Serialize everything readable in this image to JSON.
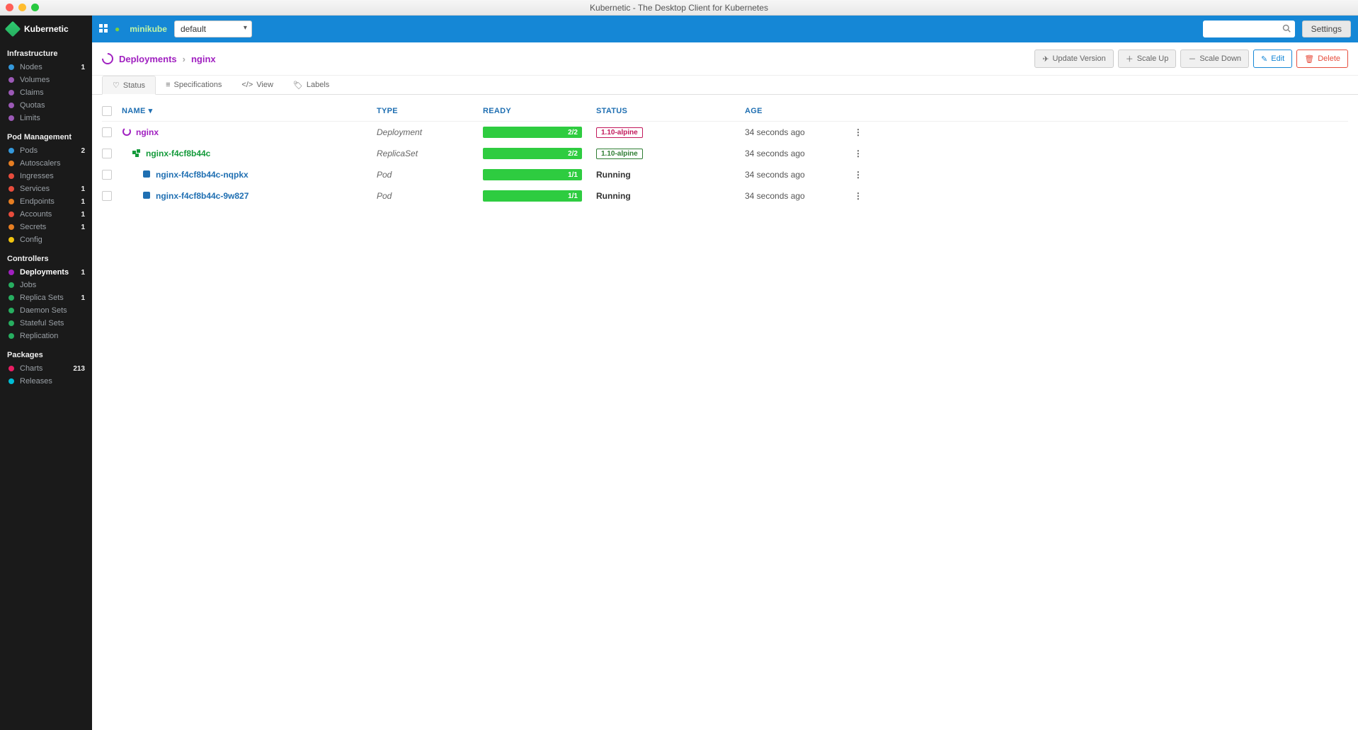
{
  "window": {
    "title": "Kubernetic - The Desktop Client for Kubernetes"
  },
  "brand": {
    "name": "Kubernetic"
  },
  "topbar": {
    "cluster": "minikube",
    "namespace": "default",
    "search_placeholder": "",
    "settings_label": "Settings"
  },
  "sidebar": {
    "sections": [
      {
        "heading": "Infrastructure",
        "items": [
          {
            "label": "Nodes",
            "badge": "1",
            "color": "#3498db"
          },
          {
            "label": "Volumes",
            "badge": "",
            "color": "#9b59b6"
          },
          {
            "label": "Claims",
            "badge": "",
            "color": "#9b59b6"
          },
          {
            "label": "Quotas",
            "badge": "",
            "color": "#9b59b6"
          },
          {
            "label": "Limits",
            "badge": "",
            "color": "#9b59b6"
          }
        ]
      },
      {
        "heading": "Pod Management",
        "items": [
          {
            "label": "Pods",
            "badge": "2",
            "color": "#3498db"
          },
          {
            "label": "Autoscalers",
            "badge": "",
            "color": "#e67e22"
          },
          {
            "label": "Ingresses",
            "badge": "",
            "color": "#e74c3c"
          },
          {
            "label": "Services",
            "badge": "1",
            "color": "#e74c3c"
          },
          {
            "label": "Endpoints",
            "badge": "1",
            "color": "#e67e22"
          },
          {
            "label": "Accounts",
            "badge": "1",
            "color": "#e74c3c"
          },
          {
            "label": "Secrets",
            "badge": "1",
            "color": "#e67e22"
          },
          {
            "label": "Config",
            "badge": "",
            "color": "#f1c40f"
          }
        ]
      },
      {
        "heading": "Controllers",
        "items": [
          {
            "label": "Deployments",
            "badge": "1",
            "color": "#a020c0",
            "active": true
          },
          {
            "label": "Jobs",
            "badge": "",
            "color": "#27ae60"
          },
          {
            "label": "Replica Sets",
            "badge": "1",
            "color": "#27ae60"
          },
          {
            "label": "Daemon Sets",
            "badge": "",
            "color": "#27ae60"
          },
          {
            "label": "Stateful Sets",
            "badge": "",
            "color": "#27ae60"
          },
          {
            "label": "Replication",
            "badge": "",
            "color": "#27ae60"
          }
        ]
      },
      {
        "heading": "Packages",
        "items": [
          {
            "label": "Charts",
            "badge": "213",
            "color": "#e91e63"
          },
          {
            "label": "Releases",
            "badge": "",
            "color": "#00bcd4"
          }
        ]
      }
    ]
  },
  "breadcrumb": {
    "root": "Deployments",
    "current": "nginx"
  },
  "actions": {
    "update_version": "Update Version",
    "scale_up": "Scale Up",
    "scale_down": "Scale Down",
    "edit": "Edit",
    "delete": "Delete"
  },
  "tabs": [
    {
      "label": "Status",
      "active": true
    },
    {
      "label": "Specifications"
    },
    {
      "label": "View"
    },
    {
      "label": "Labels"
    }
  ],
  "table": {
    "headers": {
      "name": "NAME",
      "type": "TYPE",
      "ready": "READY",
      "status": "STATUS",
      "age": "AGE"
    },
    "rows": [
      {
        "kind": "dep",
        "indent": 0,
        "name": "nginx",
        "type": "Deployment",
        "ready": "2/2",
        "status": "1.10-alpine",
        "status_style": "pink",
        "age": "34 seconds ago"
      },
      {
        "kind": "rs",
        "indent": 1,
        "name": "nginx-f4cf8b44c",
        "type": "ReplicaSet",
        "ready": "2/2",
        "status": "1.10-alpine",
        "status_style": "green",
        "age": "34 seconds ago"
      },
      {
        "kind": "pod",
        "indent": 2,
        "name": "nginx-f4cf8b44c-nqpkx",
        "type": "Pod",
        "ready": "1/1",
        "status": "Running",
        "status_style": "text",
        "age": "34 seconds ago"
      },
      {
        "kind": "pod",
        "indent": 2,
        "name": "nginx-f4cf8b44c-9w827",
        "type": "Pod",
        "ready": "1/1",
        "status": "Running",
        "status_style": "text",
        "age": "34 seconds ago"
      }
    ]
  }
}
